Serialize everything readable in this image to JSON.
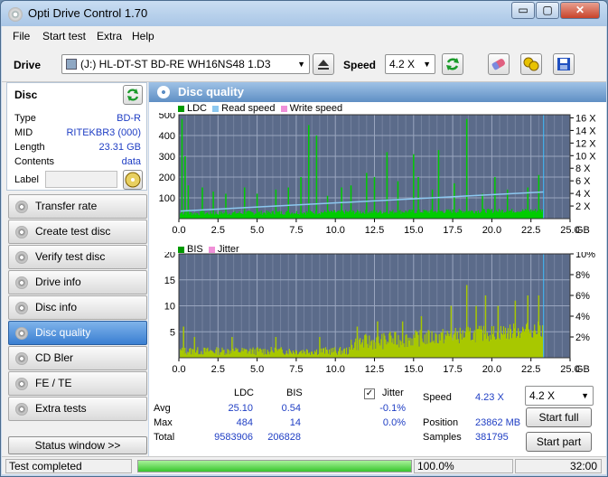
{
  "window": {
    "title": "Opti Drive Control 1.70",
    "min": "▭",
    "max": "▢",
    "close": "✕"
  },
  "menu": [
    "File",
    "Start test",
    "Extra",
    "Help"
  ],
  "toolbar": {
    "drive_label": "Drive",
    "drive_value": "(J:)   HL-DT-ST BD-RE  WH16NS48 1.D3",
    "speed_label": "Speed",
    "speed_value": "4.2 X"
  },
  "disc": {
    "header": "Disc",
    "rows": [
      {
        "k": "Type",
        "v": "BD-R"
      },
      {
        "k": "MID",
        "v": "RITEKBR3 (000)"
      },
      {
        "k": "Length",
        "v": "23.31 GB"
      },
      {
        "k": "Contents",
        "v": "data"
      }
    ],
    "label_key": "Label"
  },
  "nav": [
    {
      "name": "nav-transfer-rate",
      "label": "Transfer rate",
      "active": false
    },
    {
      "name": "nav-create-test-disc",
      "label": "Create test disc",
      "active": false
    },
    {
      "name": "nav-verify-test-disc",
      "label": "Verify test disc",
      "active": false
    },
    {
      "name": "nav-drive-info",
      "label": "Drive info",
      "active": false
    },
    {
      "name": "nav-disc-info",
      "label": "Disc info",
      "active": false
    },
    {
      "name": "nav-disc-quality",
      "label": "Disc quality",
      "active": true
    },
    {
      "name": "nav-cd-bler",
      "label": "CD Bler",
      "active": false
    },
    {
      "name": "nav-fe-te",
      "label": "FE / TE",
      "active": false
    },
    {
      "name": "nav-extra-tests",
      "label": "Extra tests",
      "active": false
    }
  ],
  "status_window_btn": "Status window >>",
  "panel_title": "Disc quality",
  "colors": {
    "ldc": "#00cc00",
    "bis": "#a8c800",
    "read": "#8cc8f0",
    "write": "#f090d8",
    "plot_bg": "#5b6b8a",
    "cursor": "#40c0ff"
  },
  "chart_data": [
    {
      "type": "bar",
      "legend": [
        "LDC",
        "Read speed",
        "Write speed"
      ],
      "x_ticks": [
        "0.0",
        "2.5",
        "5.0",
        "7.5",
        "10.0",
        "12.5",
        "15.0",
        "17.5",
        "20.0",
        "22.5",
        "25.0"
      ],
      "x_unit": "GB",
      "y_ticks": [
        "500",
        "400",
        "300",
        "200",
        "100"
      ],
      "y_right_ticks": [
        "16 X",
        "14 X",
        "12 X",
        "10 X",
        "8 X",
        "6 X",
        "4 X",
        "2 X"
      ],
      "ylim": [
        0,
        500
      ],
      "x_range": [
        0,
        25
      ],
      "cursor_x": 23.31,
      "read_speed_line": {
        "x": [
          0.1,
          23.3
        ],
        "y": [
          1.2,
          4.23
        ]
      },
      "spikes": [
        {
          "x": 0.2,
          "y": 480
        },
        {
          "x": 0.4,
          "y": 300
        },
        {
          "x": 0.6,
          "y": 160
        },
        {
          "x": 1.5,
          "y": 150
        },
        {
          "x": 2.2,
          "y": 130
        },
        {
          "x": 3.0,
          "y": 120
        },
        {
          "x": 4.2,
          "y": 150
        },
        {
          "x": 5.0,
          "y": 120
        },
        {
          "x": 6.2,
          "y": 140
        },
        {
          "x": 7.0,
          "y": 150
        },
        {
          "x": 7.8,
          "y": 200
        },
        {
          "x": 8.3,
          "y": 450
        },
        {
          "x": 8.8,
          "y": 400
        },
        {
          "x": 9.5,
          "y": 110
        },
        {
          "x": 10.4,
          "y": 150
        },
        {
          "x": 11.0,
          "y": 160
        },
        {
          "x": 12.0,
          "y": 220
        },
        {
          "x": 12.5,
          "y": 200
        },
        {
          "x": 13.3,
          "y": 320
        },
        {
          "x": 14.0,
          "y": 180
        },
        {
          "x": 15.0,
          "y": 310
        },
        {
          "x": 15.3,
          "y": 200
        },
        {
          "x": 16.2,
          "y": 140
        },
        {
          "x": 16.6,
          "y": 330
        },
        {
          "x": 17.6,
          "y": 170
        },
        {
          "x": 18.4,
          "y": 480
        },
        {
          "x": 19.4,
          "y": 120
        },
        {
          "x": 20.2,
          "y": 200
        },
        {
          "x": 21.0,
          "y": 140
        },
        {
          "x": 22.3,
          "y": 150
        },
        {
          "x": 23.0,
          "y": 210
        }
      ]
    },
    {
      "type": "bar",
      "legend": [
        "BIS",
        "Jitter"
      ],
      "x_ticks": [
        "0.0",
        "2.5",
        "5.0",
        "7.5",
        "10.0",
        "12.5",
        "15.0",
        "17.5",
        "20.0",
        "22.5",
        "25.0"
      ],
      "x_unit": "GB",
      "y_ticks": [
        "20",
        "15",
        "10",
        "5"
      ],
      "y_right_ticks": [
        "10%",
        "8%",
        "6%",
        "4%",
        "2%"
      ],
      "ylim": [
        0,
        20
      ],
      "x_range": [
        0,
        25
      ],
      "cursor_x": 23.31,
      "spikes": [
        {
          "x": 0.3,
          "y": 6
        },
        {
          "x": 1.0,
          "y": 4
        },
        {
          "x": 3.4,
          "y": 4
        },
        {
          "x": 6.2,
          "y": 4
        },
        {
          "x": 9.0,
          "y": 4
        },
        {
          "x": 11.4,
          "y": 6
        },
        {
          "x": 12.7,
          "y": 7
        },
        {
          "x": 13.5,
          "y": 5
        },
        {
          "x": 14.3,
          "y": 7
        },
        {
          "x": 15.5,
          "y": 8
        },
        {
          "x": 17.4,
          "y": 10
        },
        {
          "x": 18.4,
          "y": 14
        },
        {
          "x": 19.0,
          "y": 10
        },
        {
          "x": 19.6,
          "y": 12
        },
        {
          "x": 20.4,
          "y": 10
        },
        {
          "x": 21.5,
          "y": 11
        },
        {
          "x": 22.3,
          "y": 12
        },
        {
          "x": 23.0,
          "y": 12
        }
      ]
    }
  ],
  "stats": {
    "h_ldc": "LDC",
    "h_bis": "BIS",
    "h_jitter": "Jitter",
    "avg_label": "Avg",
    "max_label": "Max",
    "total_label": "Total",
    "avg_ldc": "25.10",
    "avg_bis": "0.54",
    "avg_jitter": "-0.1%",
    "max_ldc": "484",
    "max_bis": "14",
    "max_jitter": "0.0%",
    "total_ldc": "9583906",
    "total_bis": "206828",
    "speed_label": "Speed",
    "speed_value": "4.23 X",
    "position_label": "Position",
    "position_value": "23862 MB",
    "samples_label": "Samples",
    "samples_value": "381795",
    "speed_select": "4.2 X",
    "start_full": "Start full",
    "start_part": "Start part"
  },
  "status": {
    "text": "Test completed",
    "progress": 1.0,
    "percent": "100.0%",
    "time": "32:00"
  }
}
